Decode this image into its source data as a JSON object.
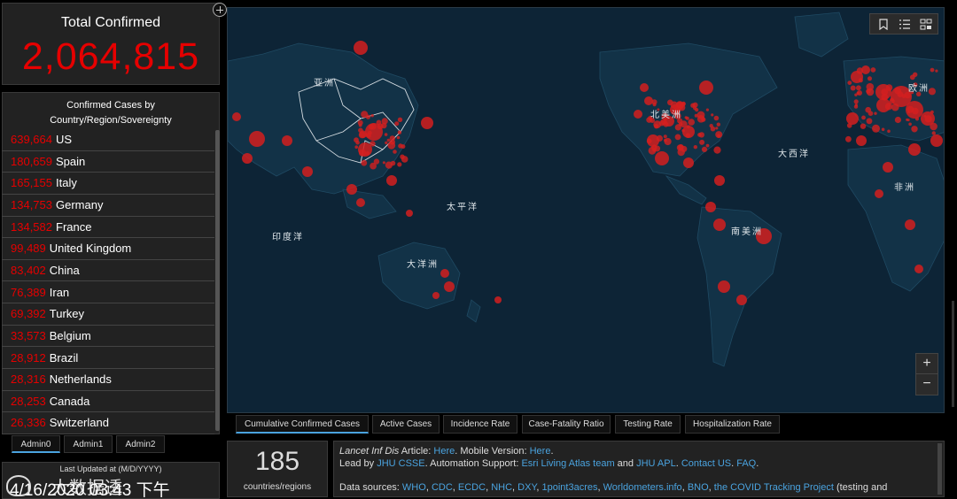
{
  "total": {
    "title": "Total Confirmed",
    "value": "2,064,815"
  },
  "list": {
    "header_line1": "Confirmed Cases by",
    "header_line2": "Country/Region/Sovereignty",
    "rows": [
      {
        "num": "639,664",
        "name": "US"
      },
      {
        "num": "180,659",
        "name": "Spain"
      },
      {
        "num": "165,155",
        "name": "Italy"
      },
      {
        "num": "134,753",
        "name": "Germany"
      },
      {
        "num": "134,582",
        "name": "France"
      },
      {
        "num": "99,489",
        "name": "United Kingdom"
      },
      {
        "num": "83,402",
        "name": "China"
      },
      {
        "num": "76,389",
        "name": "Iran"
      },
      {
        "num": "69,392",
        "name": "Turkey"
      },
      {
        "num": "33,573",
        "name": "Belgium"
      },
      {
        "num": "28,912",
        "name": "Brazil"
      },
      {
        "num": "28,316",
        "name": "Netherlands"
      },
      {
        "num": "28,253",
        "name": "Canada"
      },
      {
        "num": "26,336",
        "name": "Switzerland"
      }
    ]
  },
  "admin_tabs": [
    "Admin0",
    "Admin1",
    "Admin2"
  ],
  "updated": {
    "label": "Last Updated at (M/D/YYYY)",
    "value": "4/16/2020 03:43 下午",
    "watermark": "大数据透"
  },
  "map": {
    "labels": {
      "asia": "亚洲",
      "north_america": "北美洲",
      "europe": "欧洲",
      "atlantic": "大西洋",
      "africa": "非洲",
      "pacific": "太平洋",
      "indian": "印度洋",
      "oceania": "大洋洲",
      "south_america": "南美洲"
    },
    "tools": [
      "bookmark-icon",
      "list-icon",
      "qr-icon"
    ],
    "zoom_in": "+",
    "zoom_out": "−"
  },
  "map_tabs": [
    "Cumulative Confirmed Cases",
    "Active Cases",
    "Incidence Rate",
    "Case-Fatality Ratio",
    "Testing Rate",
    "Hospitalization Rate"
  ],
  "count": {
    "value": "185",
    "label": "countries/regions"
  },
  "info": {
    "l1_italic": "Lancet Inf Dis",
    "l1_a": " Article: ",
    "l1_link1": "Here",
    "l1_b": ". Mobile Version: ",
    "l1_link2": "Here",
    "l1_c": ".",
    "l2_a": "Lead by ",
    "l2_link1": "JHU CSSE",
    "l2_b": ". Automation Support: ",
    "l2_link2": "Esri Living Atlas team",
    "l2_c": " and ",
    "l2_link3": "JHU APL",
    "l2_d": ". ",
    "l2_link4": "Contact US",
    "l2_e": ". ",
    "l2_link5": "FAQ",
    "l2_f": ".",
    "l3_a": "Data sources: ",
    "sources": [
      "WHO",
      "CDC",
      "ECDC",
      "NHC",
      "DXY",
      "1point3acres",
      "Worldometers.info",
      "BNO",
      "the COVID Tracking Project"
    ],
    "l3_tail": " (testing and"
  },
  "colors": {
    "accent_red": "#e60000",
    "link_blue": "#4aa3df",
    "map_ocean": "#0d2436",
    "panel": "#222222"
  }
}
